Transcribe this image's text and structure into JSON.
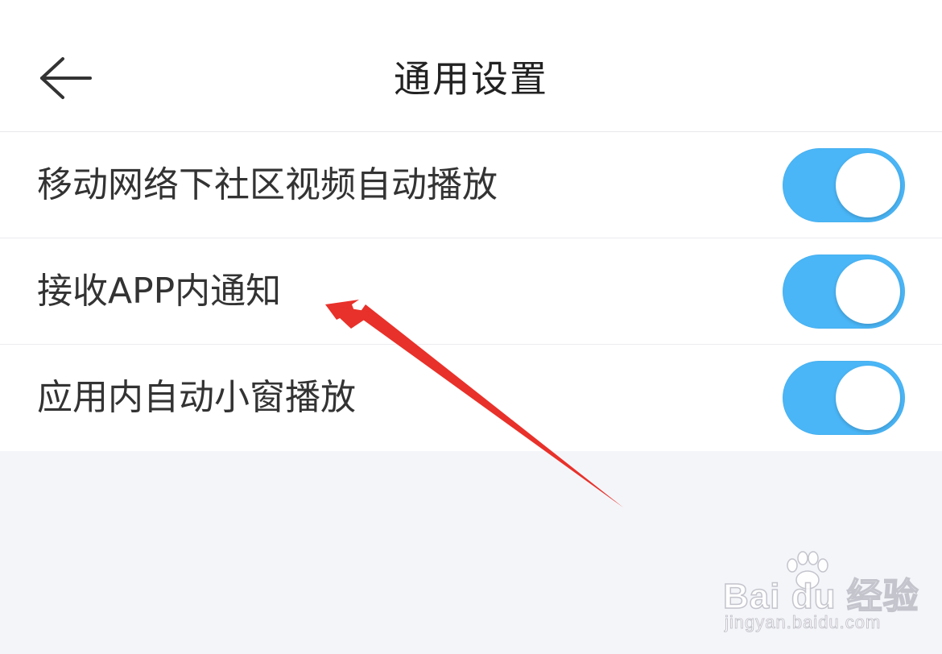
{
  "header": {
    "title": "通用设置",
    "back_icon": "arrow-left-icon"
  },
  "settings": [
    {
      "label": "移动网络下社区视频自动播放",
      "enabled": true
    },
    {
      "label": "接收APP内通知",
      "enabled": true
    },
    {
      "label": "应用内自动小窗播放",
      "enabled": true
    }
  ],
  "colors": {
    "toggle_on": "#4ab6f7",
    "annotation_arrow": "#e8312a",
    "page_background": "#f4f5f9"
  },
  "watermark": {
    "brand": "Bai du 经验",
    "url": "jingyan.baidu.com"
  }
}
